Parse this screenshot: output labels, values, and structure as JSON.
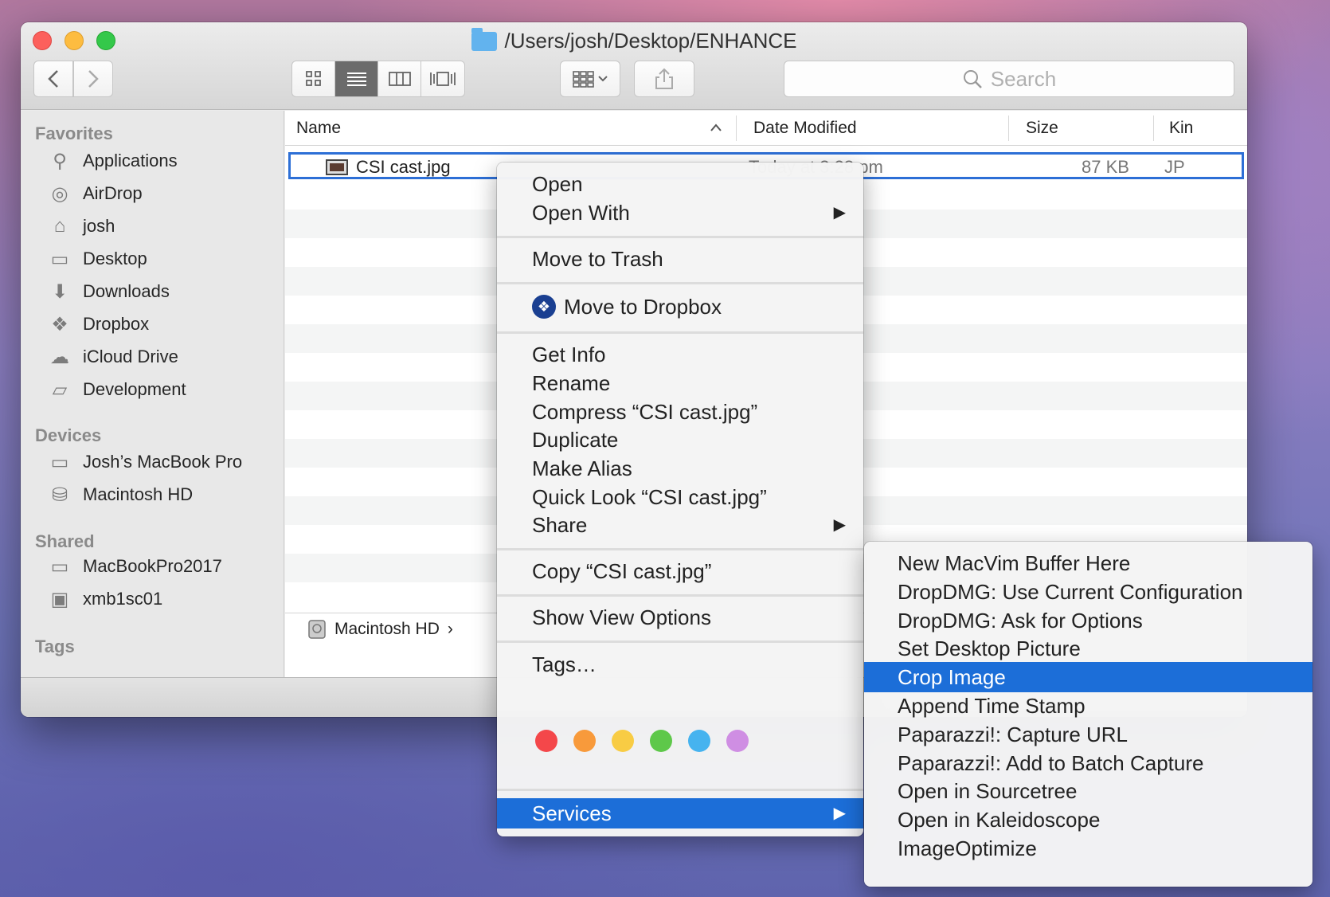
{
  "window": {
    "title": "/Users/josh/Desktop/ENHANCE",
    "search_placeholder": "Search"
  },
  "toolbar": {
    "back_label": "‹",
    "forward_label": "›",
    "view_icons": [
      "icon-view-icon",
      "list-view-icon",
      "column-view-icon",
      "cover-flow-icon"
    ]
  },
  "sidebar": {
    "sections": [
      {
        "label": "Favorites",
        "items": [
          {
            "label": "Applications",
            "icon": "applications-icon"
          },
          {
            "label": "AirDrop",
            "icon": "airdrop-icon"
          },
          {
            "label": "josh",
            "icon": "home-icon"
          },
          {
            "label": "Desktop",
            "icon": "desktop-icon"
          },
          {
            "label": "Downloads",
            "icon": "downloads-icon"
          },
          {
            "label": "Dropbox",
            "icon": "dropbox-icon"
          },
          {
            "label": "iCloud Drive",
            "icon": "cloud-icon"
          },
          {
            "label": "Development",
            "icon": "folder-icon"
          }
        ]
      },
      {
        "label": "Devices",
        "items": [
          {
            "label": "Josh’s MacBook Pro",
            "icon": "laptop-icon"
          },
          {
            "label": "Macintosh HD",
            "icon": "disk-icon"
          }
        ]
      },
      {
        "label": "Shared",
        "items": [
          {
            "label": "MacBookPro2017",
            "icon": "laptop-icon"
          },
          {
            "label": "xmb1sc01",
            "icon": "monitor-icon"
          }
        ]
      },
      {
        "label": "Tags",
        "items": []
      }
    ]
  },
  "list": {
    "columns": {
      "name": "Name",
      "date": "Date Modified",
      "size": "Size",
      "kind": "Kin"
    },
    "files": [
      {
        "name": "CSI cast.jpg",
        "date": "Today at 3:28 pm",
        "size": "87 KB",
        "kind": "JP"
      }
    ],
    "pathbar": {
      "volume": "Macintosh HD",
      "separator": "›"
    }
  },
  "context_menu": {
    "open": "Open",
    "open_with": "Open With",
    "move_to_trash": "Move to Trash",
    "move_to_dropbox": "Move to Dropbox",
    "get_info": "Get Info",
    "rename": "Rename",
    "compress": "Compress “CSI cast.jpg”",
    "duplicate": "Duplicate",
    "make_alias": "Make Alias",
    "quick_look": "Quick Look “CSI cast.jpg”",
    "share": "Share",
    "copy": "Copy “CSI cast.jpg”",
    "show_view_options": "Show View Options",
    "tags": "Tags…",
    "tag_colors": [
      "#f4474a",
      "#f89a3b",
      "#f8cc44",
      "#5ec84a",
      "#46b3ef",
      "#cf8ee3"
    ],
    "services": "Services",
    "submenu_arrow": "▶"
  },
  "services_menu": {
    "items": [
      "New MacVim Buffer Here",
      "DropDMG: Use Current Configuration",
      "DropDMG: Ask for Options",
      "Set Desktop Picture",
      "Crop Image",
      "Append Time Stamp",
      "Paparazzi!: Capture URL",
      "Paparazzi!: Add to Batch Capture",
      "Open in Sourcetree",
      "Open in Kaleidoscope",
      "ImageOptimize"
    ],
    "highlighted": "Crop Image"
  }
}
